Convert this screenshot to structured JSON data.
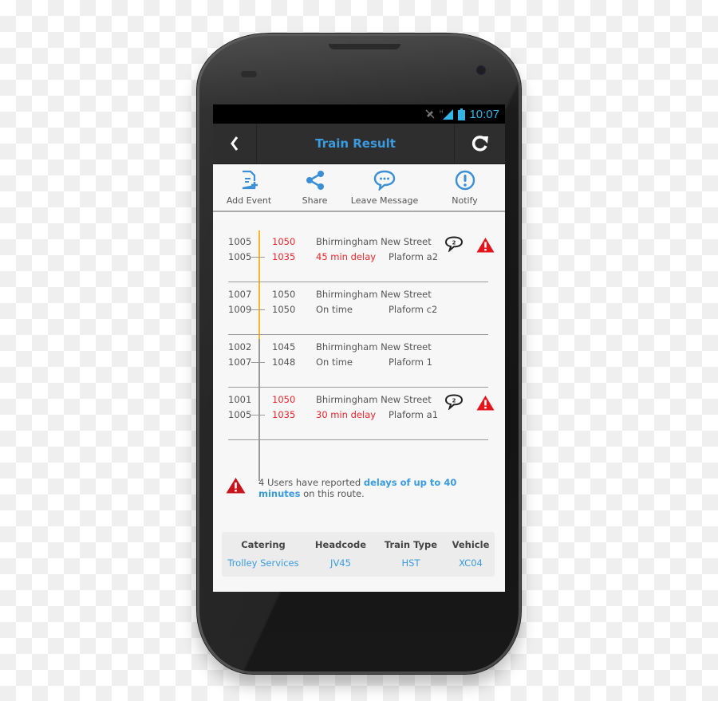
{
  "status_bar": {
    "time": "10:07",
    "icons": [
      "mute-icon",
      "signal-h-icon",
      "battery-icon"
    ]
  },
  "action_bar": {
    "back_icon": "chevron-left-icon",
    "title": "Train Result",
    "refresh_icon": "refresh-icon"
  },
  "toolbar": {
    "items": [
      {
        "label": "Add Event",
        "icon": "add-document-icon"
      },
      {
        "label": "Share",
        "icon": "share-icon"
      },
      {
        "label": "Leave Message",
        "icon": "chat-bubble-icon"
      },
      {
        "label": "Notify",
        "icon": "exclamation-circle-icon"
      }
    ]
  },
  "trains": [
    {
      "sched1": "1005",
      "time1": "1050",
      "station": "Bhirmingham New Street",
      "sched2": "1005",
      "time2": "1035",
      "status": "45 min delay",
      "platform": "Plaform a2",
      "delayed": true,
      "messages": "2",
      "warning": true
    },
    {
      "sched1": "1007",
      "time1": "1050",
      "station": "Bhirmingham New Street",
      "sched2": "1009",
      "time2": "1050",
      "status": "On time",
      "platform": "Plaform c2",
      "delayed": false
    },
    {
      "sched1": "1002",
      "time1": "1045",
      "station": "Bhirmingham New Street",
      "sched2": "1007",
      "time2": "1048",
      "status": "On time",
      "platform": "Plaform 1",
      "delayed": false
    },
    {
      "sched1": "1001",
      "time1": "1050",
      "station": "Bhirmingham New Street",
      "sched2": "1005",
      "time2": "1035",
      "status": "30 min delay",
      "platform": "Plaform a1",
      "delayed": true,
      "messages": "2",
      "warning": true
    }
  ],
  "alert": {
    "prefix": "4 Users have reported ",
    "highlight": "delays of up to 40 minutes",
    "suffix": " on this route."
  },
  "info": {
    "columns": [
      {
        "header": "Catering",
        "value": "Trolley Services"
      },
      {
        "header": "Headcode",
        "value": "JV45"
      },
      {
        "header": "Train Type",
        "value": "HST"
      },
      {
        "header": "Vehicle",
        "value": "XC04"
      }
    ]
  },
  "colors": {
    "accent": "#3a9be0",
    "delay_red": "#e8262c",
    "timeline_yellow": "#f5b829",
    "status_time": "#33b5e5"
  }
}
